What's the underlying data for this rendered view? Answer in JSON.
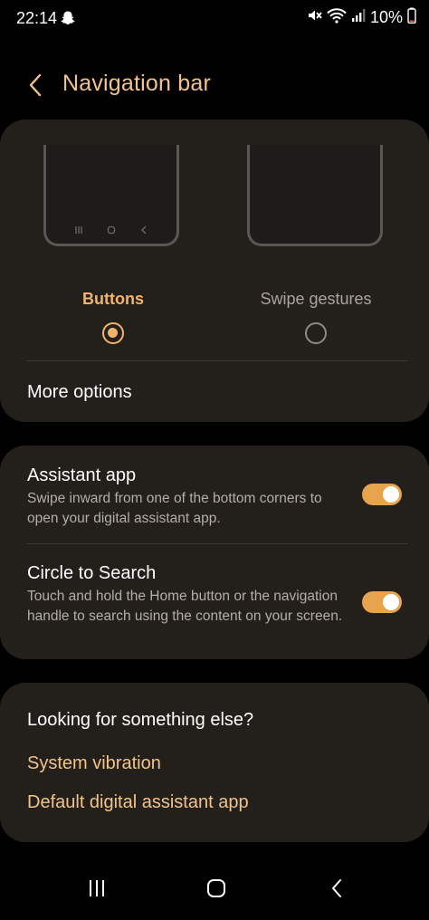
{
  "status_bar": {
    "time": "22:14",
    "battery": "10%",
    "icons": [
      "snapchat-icon",
      "mute-icon",
      "wifi-icon",
      "signal-icon",
      "battery-icon"
    ]
  },
  "header": {
    "title": "Navigation bar",
    "back_icon": "back-chevron-icon"
  },
  "navigation_type": {
    "options": [
      {
        "label": "Buttons",
        "selected": true
      },
      {
        "label": "Swipe gestures",
        "selected": false
      }
    ],
    "more_options": "More options"
  },
  "toggles": [
    {
      "title": "Assistant app",
      "description": "Swipe inward from one of the bottom corners to open your digital assistant app.",
      "on": true
    },
    {
      "title": "Circle to Search",
      "description": "Touch and hold the Home button or the navigation handle to search using the content on your screen.",
      "on": true
    }
  ],
  "looking": {
    "heading": "Looking for something else?",
    "links": [
      "System vibration",
      "Default digital assistant app"
    ]
  },
  "colors": {
    "accent": "#f2b46d",
    "title": "#f2c38a",
    "toggle_on": "#e8a34d",
    "card": "#231f1b",
    "background": "#000000"
  }
}
